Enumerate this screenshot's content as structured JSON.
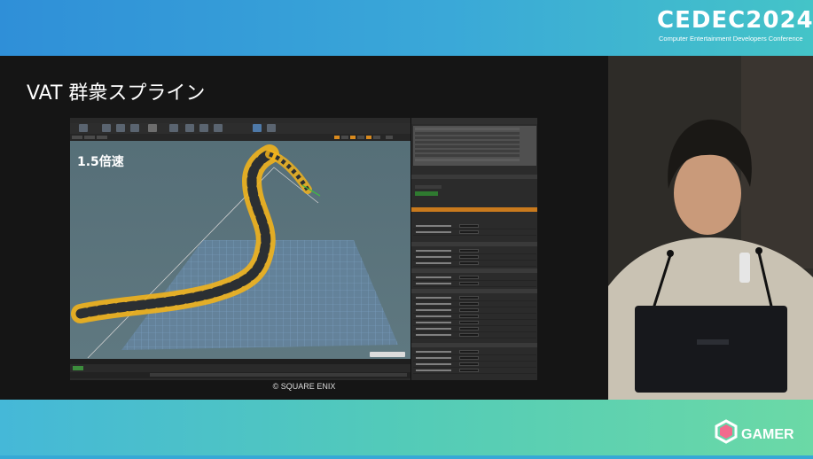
{
  "event_logo": {
    "name": "CEDEC2024",
    "tagline": "Computer Entertainment Developers Conference"
  },
  "slide": {
    "title": "VAT 群衆スプライン",
    "copyright": "© SQUARE ENIX"
  },
  "editor": {
    "speed_label": "1.5倍速"
  },
  "watermark": {
    "name": "GAMER"
  },
  "colors": {
    "accent_orange": "#d98a1e",
    "crowd_yellow": "#f1b21c",
    "viewport_sky": "#5f7880",
    "band_blue": "#2f8fd8",
    "band_green": "#6bd9a6"
  }
}
